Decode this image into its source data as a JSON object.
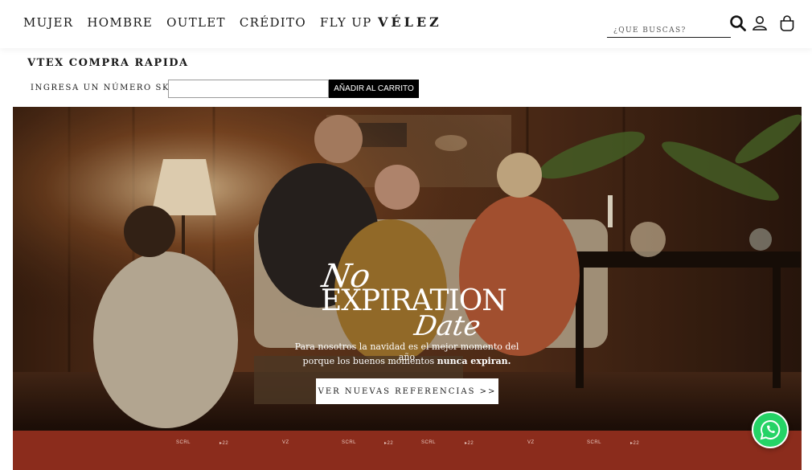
{
  "header": {
    "nav": [
      "MUJER",
      "HOMBRE",
      "OUTLET",
      "CRÉDITO",
      "FLY UP"
    ],
    "logo": "VÉLEZ",
    "search_placeholder": "¿QUE BUSCAS?",
    "icons": [
      "search-icon",
      "user-icon",
      "shopping-bag-icon"
    ]
  },
  "quick_buy": {
    "title": "VTEX COMPRA RAPIDA",
    "label": "INGRESA UN NÚMERO SKU",
    "input_value": "",
    "button": "AÑADIR AL CARRITO"
  },
  "hero": {
    "headline_no": "No",
    "headline_expiration": "EXPIRATION",
    "headline_date": "Date",
    "subtitle_line1": "Para nosotros la navidad es el mejor momento del año",
    "subtitle_line2_prefix": "porque los buenos momentos ",
    "subtitle_line2_bold": "nunca expiran.",
    "cta": "VER NUEVAS REFERENCIAS >>"
  },
  "brand_strip": {
    "color": "#8b2c1c",
    "logos": [
      "SCRL",
      "▸22",
      "VZ",
      "SCRL",
      "▸22",
      "SCRL",
      "▸22",
      "VZ",
      "SCRL",
      "▸22"
    ]
  },
  "colors": {
    "accent": "#000000",
    "whatsapp": "#25d366"
  },
  "floating": {
    "whatsapp_icon": "whatsapp-icon"
  }
}
